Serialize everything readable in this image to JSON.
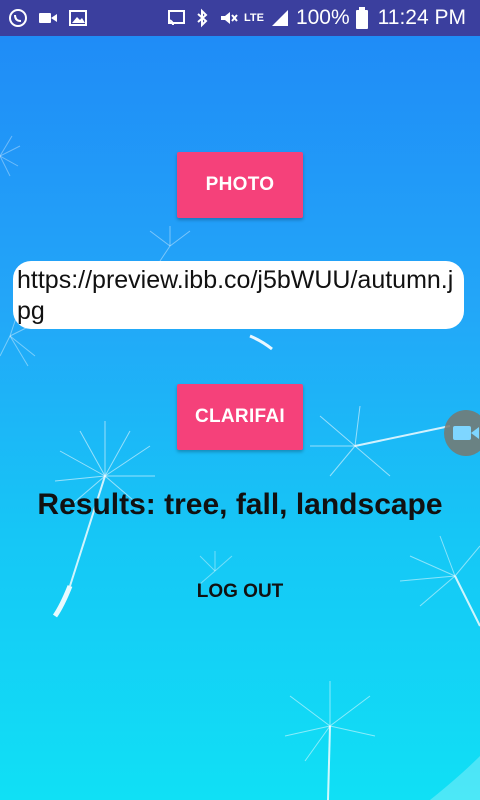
{
  "status_bar": {
    "battery": "100%",
    "time": "11:24 PM",
    "network": "LTE",
    "icons": [
      "viber-icon",
      "video-icon",
      "image-icon",
      "cast-icon",
      "bluetooth-icon",
      "mute-icon",
      "lte-icon",
      "signal-icon",
      "battery-icon"
    ]
  },
  "main": {
    "photo_button": "PHOTO",
    "url_value": "https://preview.ibb.co/j5bWUU/autumn.jpg",
    "clarifai_button": "CLARIFAI",
    "results_text": "Results: tree, fall, landscape",
    "logout_button": "LOG OUT"
  },
  "colors": {
    "accent": "#f5417a",
    "status_bar": "#3b3f9e",
    "bg_top": "#1f8cf7",
    "bg_bottom": "#10e0f5"
  }
}
